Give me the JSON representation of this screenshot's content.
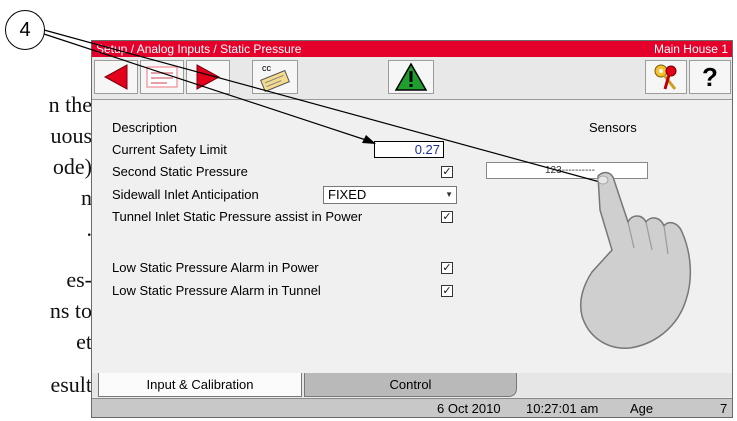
{
  "manual": {
    "callout_number": "4",
    "lines": [
      "n the",
      "uous",
      "ode)",
      "n",
      ".",
      "es-",
      "ns to",
      "et",
      "esult"
    ]
  },
  "screen": {
    "breadcrumb": "Setup / Analog Inputs / Static Pressure",
    "house": "Main House 1",
    "toolbar": {
      "icons": [
        "back-arrow-icon",
        "list-icon",
        "forward-arrow-icon",
        "cc-card-icon",
        "alarm-warning-icon",
        "keys-icon",
        "help-icon"
      ],
      "help_label": "?",
      "cc_label": "cc"
    },
    "headers": {
      "description": "Description",
      "sensors": "Sensors"
    },
    "rows": {
      "safety_limit": {
        "label": "Current Safety Limit",
        "value": "0.27"
      },
      "second_static": {
        "label": "Second Static Pressure",
        "checked": true,
        "sensor_value": "123----------"
      },
      "sidewall_anticipation": {
        "label": "Sidewall Inlet Anticipation",
        "selected": "FIXED"
      },
      "tunnel_assist": {
        "label": "Tunnel Inlet Static Pressure assist in Power",
        "checked": true
      },
      "low_alarm_power": {
        "label": "Low Static Pressure Alarm in Power",
        "checked": true
      },
      "low_alarm_tunnel": {
        "label": "Low Static Pressure Alarm in Tunnel",
        "checked": true
      }
    },
    "check_glyph": "✓",
    "tabs": [
      "Input & Calibration",
      "Control"
    ],
    "status": {
      "date": "6 Oct 2010",
      "time": "10:27:01 am",
      "age_label": "Age",
      "age_value": "7"
    }
  },
  "colors": {
    "title_bar": "#e4002b",
    "arrow_red": "#e3001b",
    "warning_green": "#1f9d2e",
    "value_blue": "#1a2f9c"
  }
}
